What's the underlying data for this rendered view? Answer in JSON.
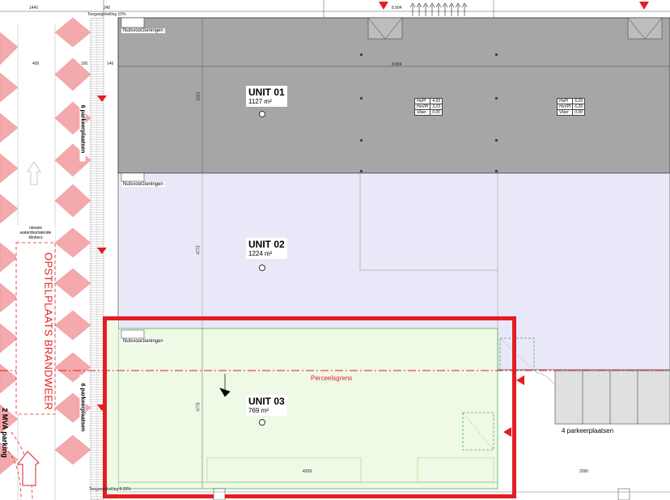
{
  "units": [
    {
      "name": "UNIT 01",
      "area": "1127 m²",
      "color": "#a6a6a6"
    },
    {
      "name": "UNIT 02",
      "area": "1224 m²",
      "color": "#e8e8f8"
    },
    {
      "name": "UNIT 03",
      "area": "769 m²",
      "color": "#eef9e6"
    }
  ],
  "utilities_label": "Nutsvoorzieningen",
  "parking_left_top": "6 parkeerplaatsen",
  "parking_left_bottom": "6 parkeerplaatsen",
  "parking_right": "4 parkeerplaatsen",
  "fire_brigade_zone": "OPSTELPLAATS BRANDWEER",
  "parcel_boundary": "Perceelsgrens",
  "pavement_note": [
    "nieuwe",
    "waterdoorlatende",
    "klinkers"
  ],
  "slope_top": "Toegangshelling 10%",
  "slope_bottom": "Toegangshelling 8.33%",
  "edge_text_left": "2 MVA parking",
  "ratio_tables": [
    {
      "rows": [
        [
          "HoPl",
          "4.93"
        ],
        [
          "HoVPl",
          "3.23"
        ],
        [
          "Vloer",
          "0.00"
        ]
      ]
    },
    {
      "rows": [
        [
          "HoPl",
          "6.29"
        ],
        [
          "HoVPl",
          "6.29"
        ],
        [
          "Vloer",
          "0.00"
        ]
      ]
    }
  ],
  "dims": {
    "top_a": "1440",
    "top_b": "240",
    "top_c": "8.904",
    "left_a": "400",
    "left_b": "160",
    "left_c": "146",
    "mid": "8.904",
    "bottom_a": "4209",
    "bottom_b": "2090",
    "v_a": "1613",
    "v_b": "4773",
    "v_c": "4775"
  },
  "accent": "#e31e24",
  "hatch_color": "#f4a9ad"
}
